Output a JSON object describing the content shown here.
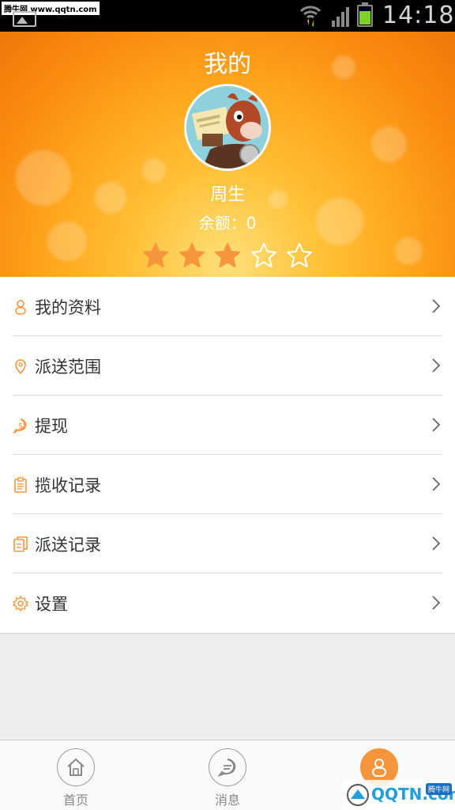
{
  "status_bar": {
    "time": "14:18",
    "watermark": "腾牛网 www.qqtn.com"
  },
  "header": {
    "title": "我的",
    "username": "周生",
    "balance_label": "余额：",
    "balance_value": "0",
    "rating": 3,
    "rating_max": 5
  },
  "menu": {
    "items": [
      {
        "label": "我的资料",
        "icon": "user-icon"
      },
      {
        "label": "派送范围",
        "icon": "location-pin-icon"
      },
      {
        "label": "提现",
        "icon": "money-icon"
      },
      {
        "label": "揽收记录",
        "icon": "clipboard-icon"
      },
      {
        "label": "派送记录",
        "icon": "documents-icon"
      },
      {
        "label": "设置",
        "icon": "gear-icon"
      }
    ]
  },
  "bottom_nav": {
    "items": [
      {
        "label": "首页",
        "icon": "home-icon"
      },
      {
        "label": "消息",
        "icon": "message-icon"
      },
      {
        "label": "",
        "icon": "user-icon",
        "active": true
      }
    ]
  },
  "watermark_br": {
    "text": "QQTN.com",
    "badge": "腾牛网"
  },
  "colors": {
    "accent": "#f7953d",
    "star": "#f7953d",
    "header_orange": "#f98a10"
  }
}
